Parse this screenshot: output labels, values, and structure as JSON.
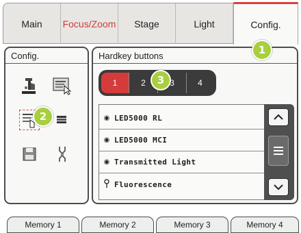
{
  "tabs": [
    {
      "label": "Main"
    },
    {
      "label": "Focus/Zoom"
    },
    {
      "label": "Stage"
    },
    {
      "label": "Light"
    },
    {
      "label": "Config."
    }
  ],
  "active_tab": "Config.",
  "config_panel": {
    "title": "Config.",
    "icons": [
      "microscope-icon",
      "display-settings-icon",
      "touch-list-icon",
      "stack-icon",
      "save-icon",
      "tools-icon"
    ]
  },
  "hardkey_panel": {
    "title": "Hardkey buttons",
    "buttons": [
      "1",
      "2",
      "3",
      "4"
    ],
    "selected_button": "1",
    "items": [
      {
        "label": "LED5000 RL",
        "icon": "radio-dot-icon"
      },
      {
        "label": "LED5000 MCI",
        "icon": "radio-dot-icon"
      },
      {
        "label": "Transmitted Light",
        "icon": "radio-dot-icon"
      },
      {
        "label": "Fluorescence",
        "icon": "pin-icon"
      }
    ]
  },
  "callouts": [
    "1",
    "2",
    "3"
  ],
  "memory_tabs": [
    "Memory 1",
    "Memory 2",
    "Memory 3",
    "Memory 4"
  ],
  "colors": {
    "accent_red": "#d63b3b",
    "callout_green": "#a8cf3d"
  }
}
